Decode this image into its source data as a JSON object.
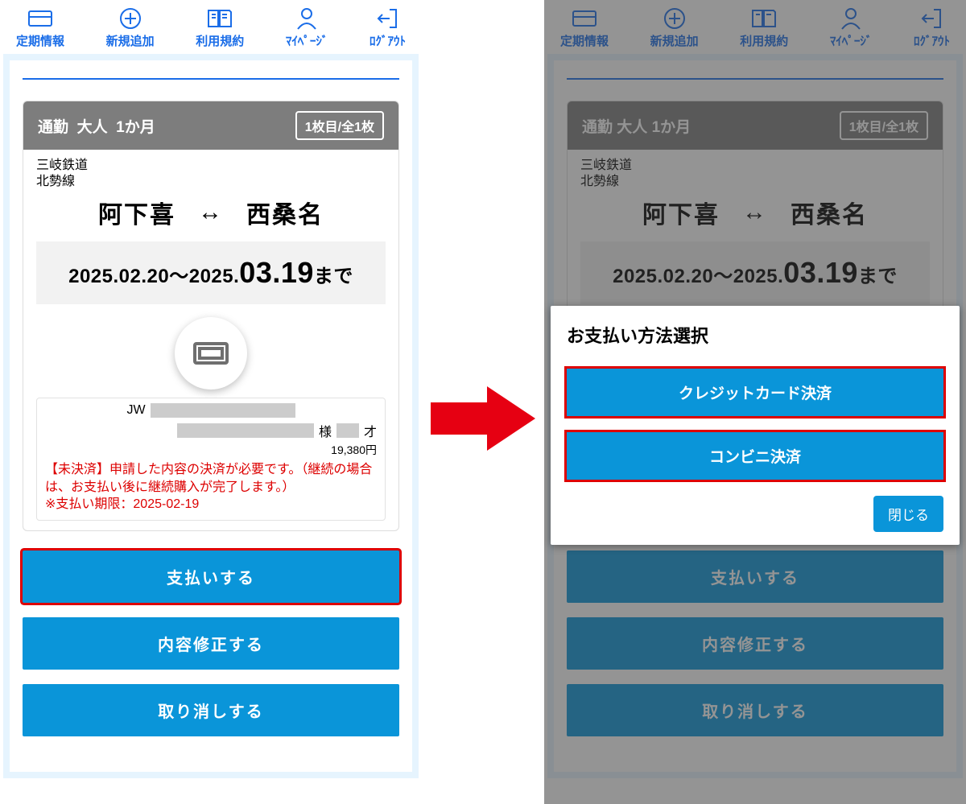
{
  "nav": [
    {
      "label": "定期情報"
    },
    {
      "label": "新規追加"
    },
    {
      "label": "利用規約"
    },
    {
      "label": "ﾏｲﾍﾟｰｼﾞ"
    },
    {
      "label": "ﾛｸﾞｱｳﾄ"
    }
  ],
  "card": {
    "fare_type": "通勤",
    "age_type": "大人",
    "duration": "1か月",
    "sheet": "1枚目/全1枚",
    "company": "三岐鉄道",
    "line": "北勢線",
    "from": "阿下喜",
    "to": "西桑名",
    "period_from": "2025.02.20",
    "period_to_big": "03.19",
    "period_to_year": "2025.",
    "period_suffix": "まで",
    "ref_prefix": "JW",
    "honorific": "様",
    "age_unit": "才",
    "price": "19,380円",
    "warn_line1": "【未決済】申請した内容の決済が必要です。（継続の場合は、お支払い後に継続購入が完了します。）",
    "warn_line2": "※支払い期限：2025-02-19"
  },
  "buttons": {
    "pay": "支払いする",
    "edit": "内容修正する",
    "cancel": "取り消しする"
  },
  "modal": {
    "title": "お支払い方法選択",
    "credit": "クレジットカード決済",
    "conv": "コンビニ決済",
    "close": "閉じる"
  }
}
